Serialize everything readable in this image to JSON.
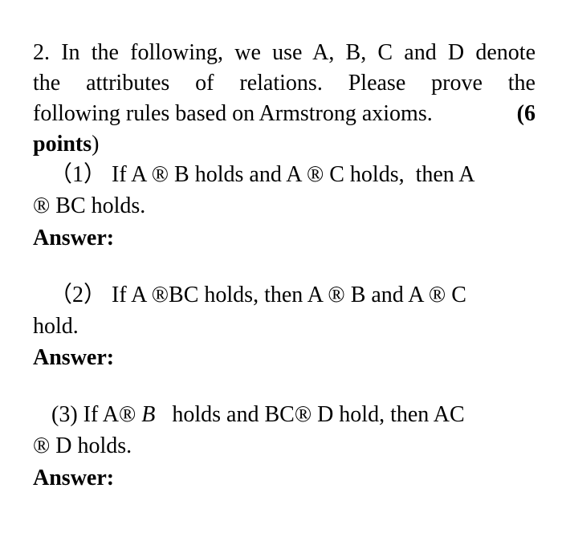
{
  "question": {
    "intro_lines": [
      "2. In the following, we use A, B, C and D denote",
      "the attributes of relations. Please prove the",
      "following rules based on Armstrong axioms."
    ],
    "points_open": "(6",
    "points_word": "points",
    "points_close": ")"
  },
  "parts": [
    {
      "line1": "（1） If A ® B holds and A ® C holds,  then A",
      "line2": "® BC holds.",
      "answer_label": "Answer:"
    },
    {
      "line1": "（2） If A ®BC holds, then A ® B and A ® C",
      "line2": "hold.",
      "answer_label": "Answer:"
    },
    {
      "line1_pre": "(3) If A® ",
      "line1_ital": "B",
      "line1_post": "   holds and BC® D hold, then AC",
      "line2": "® D holds.",
      "answer_label": "Answer:"
    }
  ]
}
